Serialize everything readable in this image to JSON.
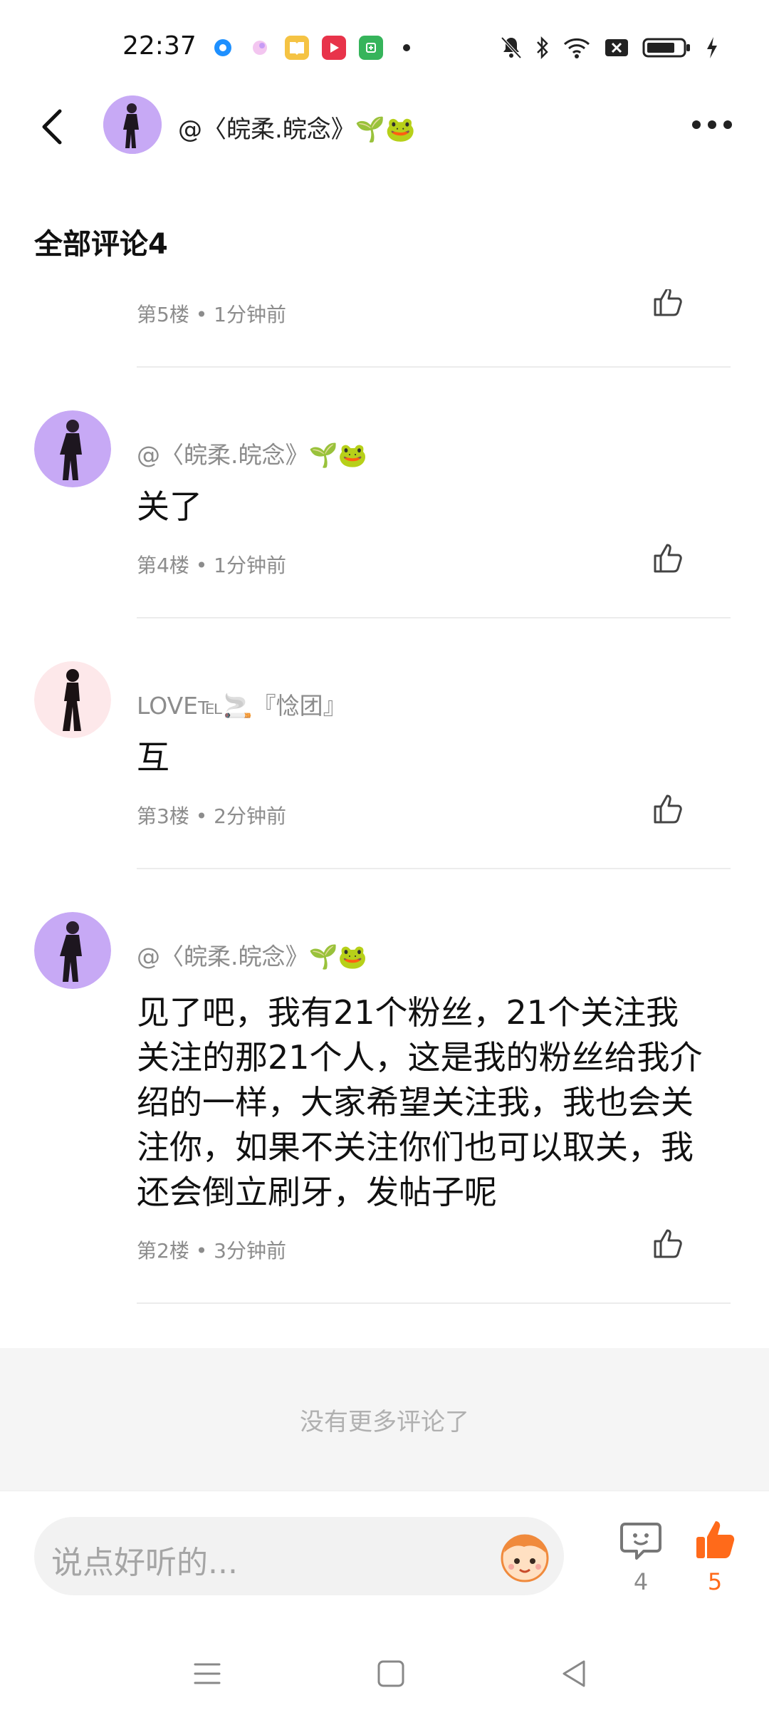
{
  "status_bar": {
    "time": "22:37"
  },
  "header": {
    "user_name": "@〈皖柔.皖念》🌱🐸"
  },
  "section_title": "全部评论4",
  "comments": [
    {
      "name": "",
      "text": "",
      "floor": "第5楼",
      "time": "1分钟前"
    },
    {
      "name": "@〈皖柔.皖念》🌱🐸",
      "text": "关了",
      "floor": "第4楼",
      "time": "1分钟前"
    },
    {
      "name": "LOVE℡🚬『惗团』",
      "text": "互",
      "floor": "第3楼",
      "time": "2分钟前"
    },
    {
      "name": "@〈皖柔.皖念》🌱🐸",
      "text": "见了吧，我有21个粉丝，21个关注我关注的那21个人，这是我的粉丝给我介绍的一样，大家希望关注我，我也会关注你，如果不关注你们也可以取关，我还会倒立刷牙，发帖子呢",
      "floor": "第2楼",
      "time": "3分钟前"
    }
  ],
  "meta_separator": "•",
  "no_more_text": "没有更多评论了",
  "bottom_bar": {
    "input_placeholder": "说点好听的...",
    "comment_count": "4",
    "like_count": "5"
  },
  "colors": {
    "accent": "#ff6a1a",
    "meta_gray": "#8c8c8c",
    "avatar_purple": "#c7a9f5",
    "avatar_pink": "#fde8ea"
  },
  "icons": [
    "back-arrow-icon",
    "more-icon",
    "like-icon",
    "comment-icon",
    "thumbs-up-filled-icon",
    "emoji-face-icon",
    "menu-icon",
    "home-icon",
    "back-nav-icon"
  ]
}
